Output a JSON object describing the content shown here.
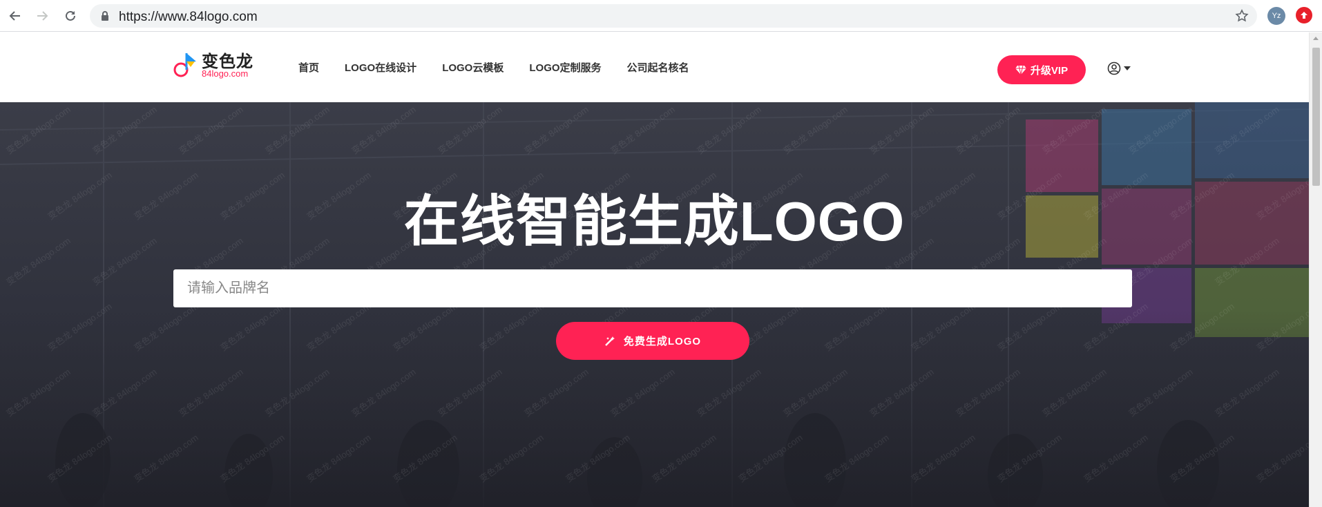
{
  "browser": {
    "url": "https://www.84logo.com",
    "profile_initials": "Yz"
  },
  "site": {
    "logo_cn": "变色龙",
    "logo_en": "84logo.com",
    "nav": [
      "首页",
      "LOGO在线设计",
      "LOGO云模板",
      "LOGO定制服务",
      "公司起名核名"
    ],
    "vip_label": "升级VIP",
    "accent": "#ff2254"
  },
  "hero": {
    "title": "在线智能生成LOGO",
    "search_placeholder": "请输入品牌名",
    "generate_label": "免费生成LOGO",
    "watermark_text": "变色龙 84logo.com"
  }
}
